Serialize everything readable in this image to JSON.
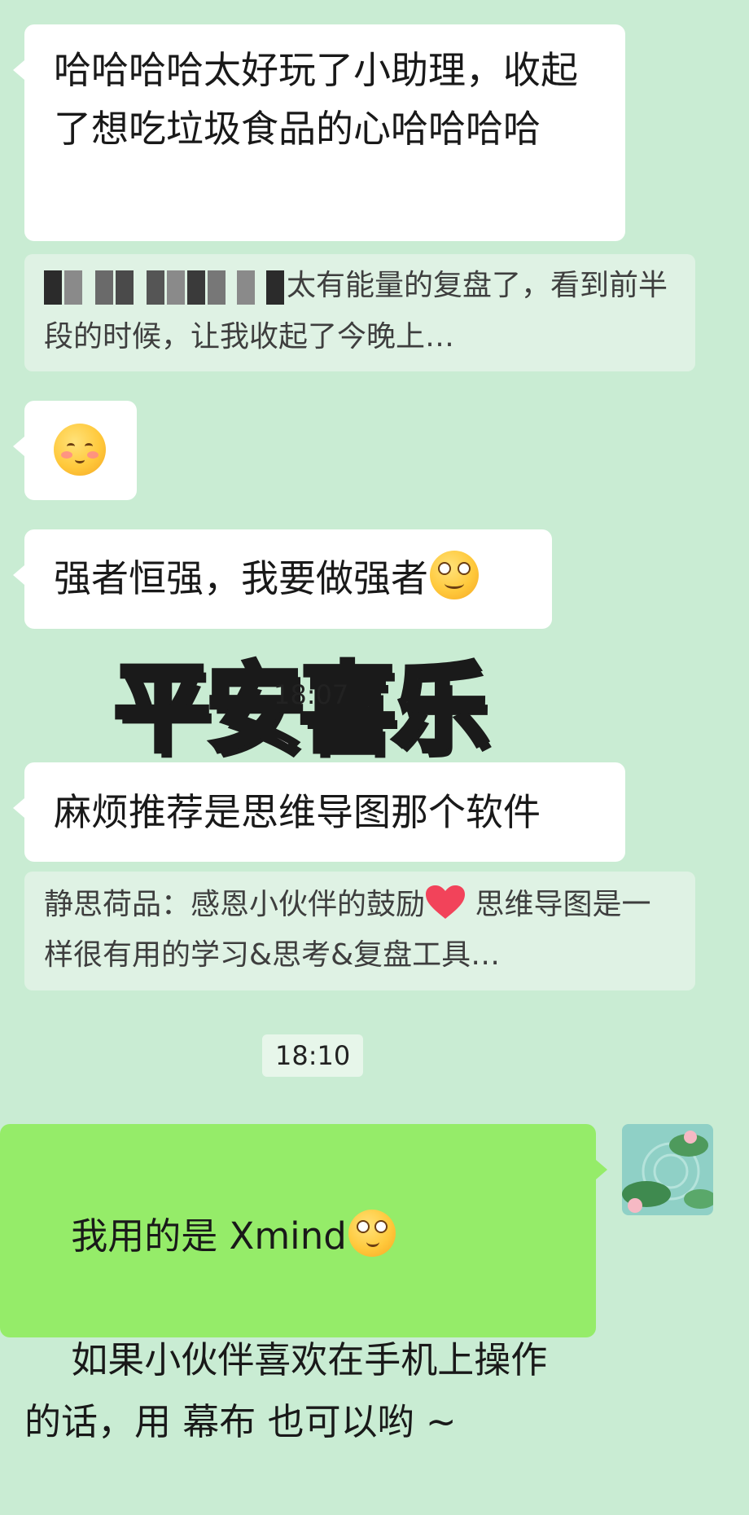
{
  "messages": {
    "m1": "哈哈哈哈太好玩了小助理，收起了想吃垃圾食品的心哈哈哈哈",
    "quote1": "太有能量的复盘了，看到前半段的时候，让我收起了今晚上…",
    "m3": "强者恒强，我要做强者",
    "sticker": "平安喜乐",
    "sticker_time": "18:07",
    "m4": "麻烦推荐是思维导图那个软件",
    "quote2_prefix": "静思荷品：感恩小伙伴的鼓励",
    "quote2_suffix": " 思维导图是一样很有用的学习&思考&复盘工具…",
    "time2": "18:10",
    "reply_line1": "我用的是 Xmind",
    "reply_line2": "如果小伙伴喜欢在手机上操作的话，用 幕布 也可以哟 ~"
  },
  "icons": {
    "emoji_blush": "blushing-smile-emoji-icon",
    "emoji_goofy": "goofy-eyes-emoji-icon",
    "emoji_heart": "red-heart-icon",
    "emoji_thinking": "thinking-face-emoji-icon",
    "avatar": "lotus-pond-avatar"
  },
  "colors": {
    "background": "#c9ecd3",
    "bubble_other": "#ffffff",
    "bubble_self": "#95ec69",
    "quote_bg": "#dff2e4"
  }
}
